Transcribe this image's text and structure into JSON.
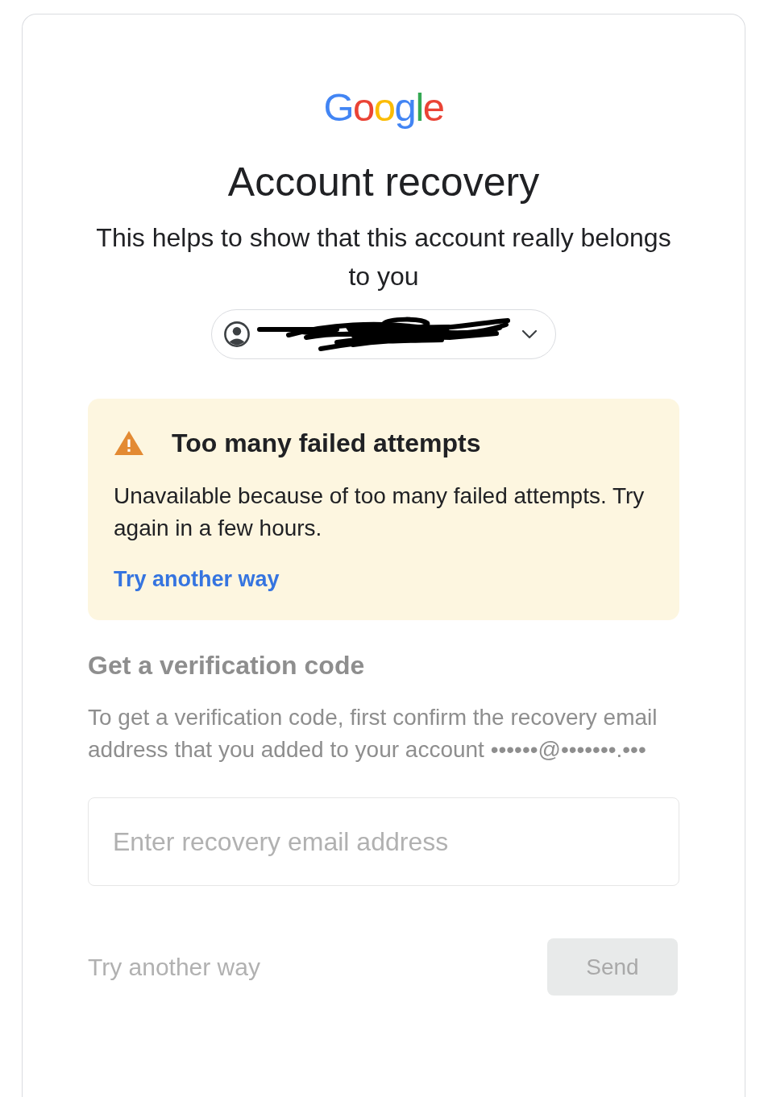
{
  "logo": {
    "text": "Google"
  },
  "title": "Account recovery",
  "subtitle": "This helps to show that this account really belongs to you",
  "account_chip": {
    "redacted": true
  },
  "warning": {
    "title": "Too many failed attempts",
    "message": "Unavailable because of too many failed attempts. Try again in a few hours.",
    "link": "Try another way"
  },
  "verification": {
    "disabled": true,
    "heading": "Get a verification code",
    "description": "To get a verification code, first confirm the recovery email address that you added to your account ••••••@•••••••.•••",
    "email_field": {
      "placeholder": "Enter recovery email address"
    },
    "alternate_link": "Try another way",
    "send_button": "Send"
  }
}
